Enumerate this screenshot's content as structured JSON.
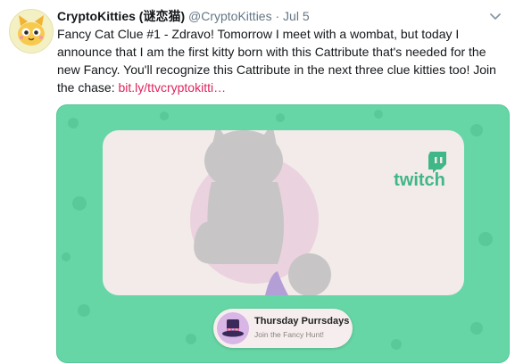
{
  "tweet": {
    "author_name": "CryptoKitties (谜恋猫)",
    "handle": "@CryptoKitties",
    "separator": "·",
    "date": "Jul 5",
    "text": "Fancy Cat Clue #1 - Zdravo! Tomorrow I meet with a wombat, but today I announce that I am the first kitty born with this Cattribute that's needed for the new Fancy. You'll recognize this Cattribute in the next three clue kitties too! Join the chase: ",
    "link_text": "bit.ly/ttvcryptokitti…"
  },
  "media": {
    "brand_logo_text": "twitch",
    "pill_title": "Thursday Purrsdays",
    "pill_subtitle": "Join the Fancy Hunt!"
  },
  "colors": {
    "media_background": "#66d6a6",
    "link": "#e0245e",
    "twitch_logo": "#3fb787"
  },
  "icons": [
    "cryptokitty-avatar-icon",
    "chevron-down-icon",
    "twitch-logo-icon",
    "top-hat-icon",
    "silhouette-kitty-icon"
  ]
}
